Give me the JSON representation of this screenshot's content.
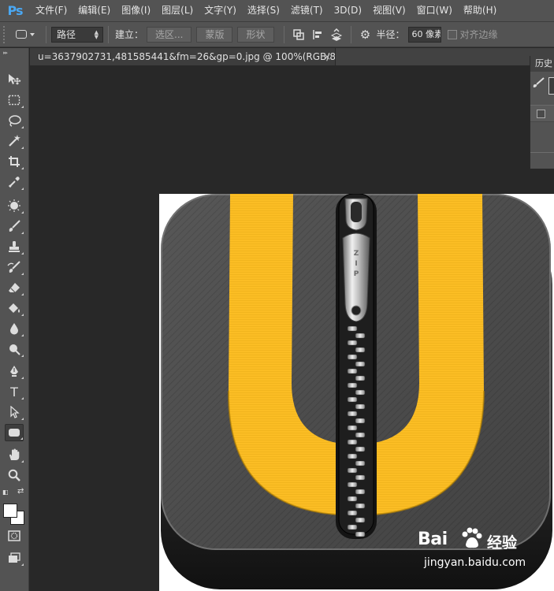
{
  "app": {
    "logo": "Ps"
  },
  "menu": [
    "文件(F)",
    "编辑(E)",
    "图像(I)",
    "图层(L)",
    "文字(Y)",
    "选择(S)",
    "滤镜(T)",
    "3D(D)",
    "视图(V)",
    "窗口(W)",
    "帮助(H)"
  ],
  "options": {
    "mode_value": "路径",
    "make_label": "建立：",
    "selection_button": "选区...",
    "mask_button": "蒙版",
    "shape_button": "形状",
    "radius_label": "半径：",
    "radius_value": "60 像素",
    "align_edges_label": "对齐边缘"
  },
  "document": {
    "tab_title": "u=3637902731,481585441&fm=26&gp=0.jpg @ 100%(RGB/8#)",
    "close_glyph": "×"
  },
  "panel": {
    "title": "历史"
  },
  "canvas": {
    "zipper_tag": "ZIP",
    "colors": {
      "tile": "#4d4d4d",
      "band": "#fbbd24",
      "zipper": "#1a1a1a"
    }
  },
  "tools": [
    {
      "name": "move-tool",
      "icon": "move-icon"
    },
    {
      "name": "marquee-tool",
      "icon": "marquee-icon"
    },
    {
      "name": "lasso-tool",
      "icon": "lasso-icon"
    },
    {
      "name": "magic-wand-tool",
      "icon": "magic-wand-icon"
    },
    {
      "name": "crop-tool",
      "icon": "crop-icon"
    },
    {
      "name": "eyedropper-tool",
      "icon": "eyedropper-icon"
    },
    {
      "name": "spot-healing-tool",
      "icon": "healing-icon"
    },
    {
      "name": "brush-tool",
      "icon": "brush-icon"
    },
    {
      "name": "clone-stamp-tool",
      "icon": "stamp-icon"
    },
    {
      "name": "history-brush-tool",
      "icon": "history-brush-icon"
    },
    {
      "name": "eraser-tool",
      "icon": "eraser-icon"
    },
    {
      "name": "paint-bucket-tool",
      "icon": "bucket-icon"
    },
    {
      "name": "blur-tool",
      "icon": "blur-icon"
    },
    {
      "name": "dodge-tool",
      "icon": "dodge-icon"
    },
    {
      "name": "pen-tool",
      "icon": "pen-icon"
    },
    {
      "name": "type-tool",
      "icon": "type-icon",
      "glyph": "T"
    },
    {
      "name": "path-selection-tool",
      "icon": "path-select-icon"
    },
    {
      "name": "rounded-rectangle-tool",
      "icon": "rounded-rect-icon",
      "active": true
    },
    {
      "name": "hand-tool",
      "icon": "hand-icon"
    },
    {
      "name": "zoom-tool",
      "icon": "zoom-icon"
    }
  ],
  "watermark": {
    "brand": "Bai",
    "brand_suffix": "经验",
    "url": "jingyan.baidu.com"
  }
}
